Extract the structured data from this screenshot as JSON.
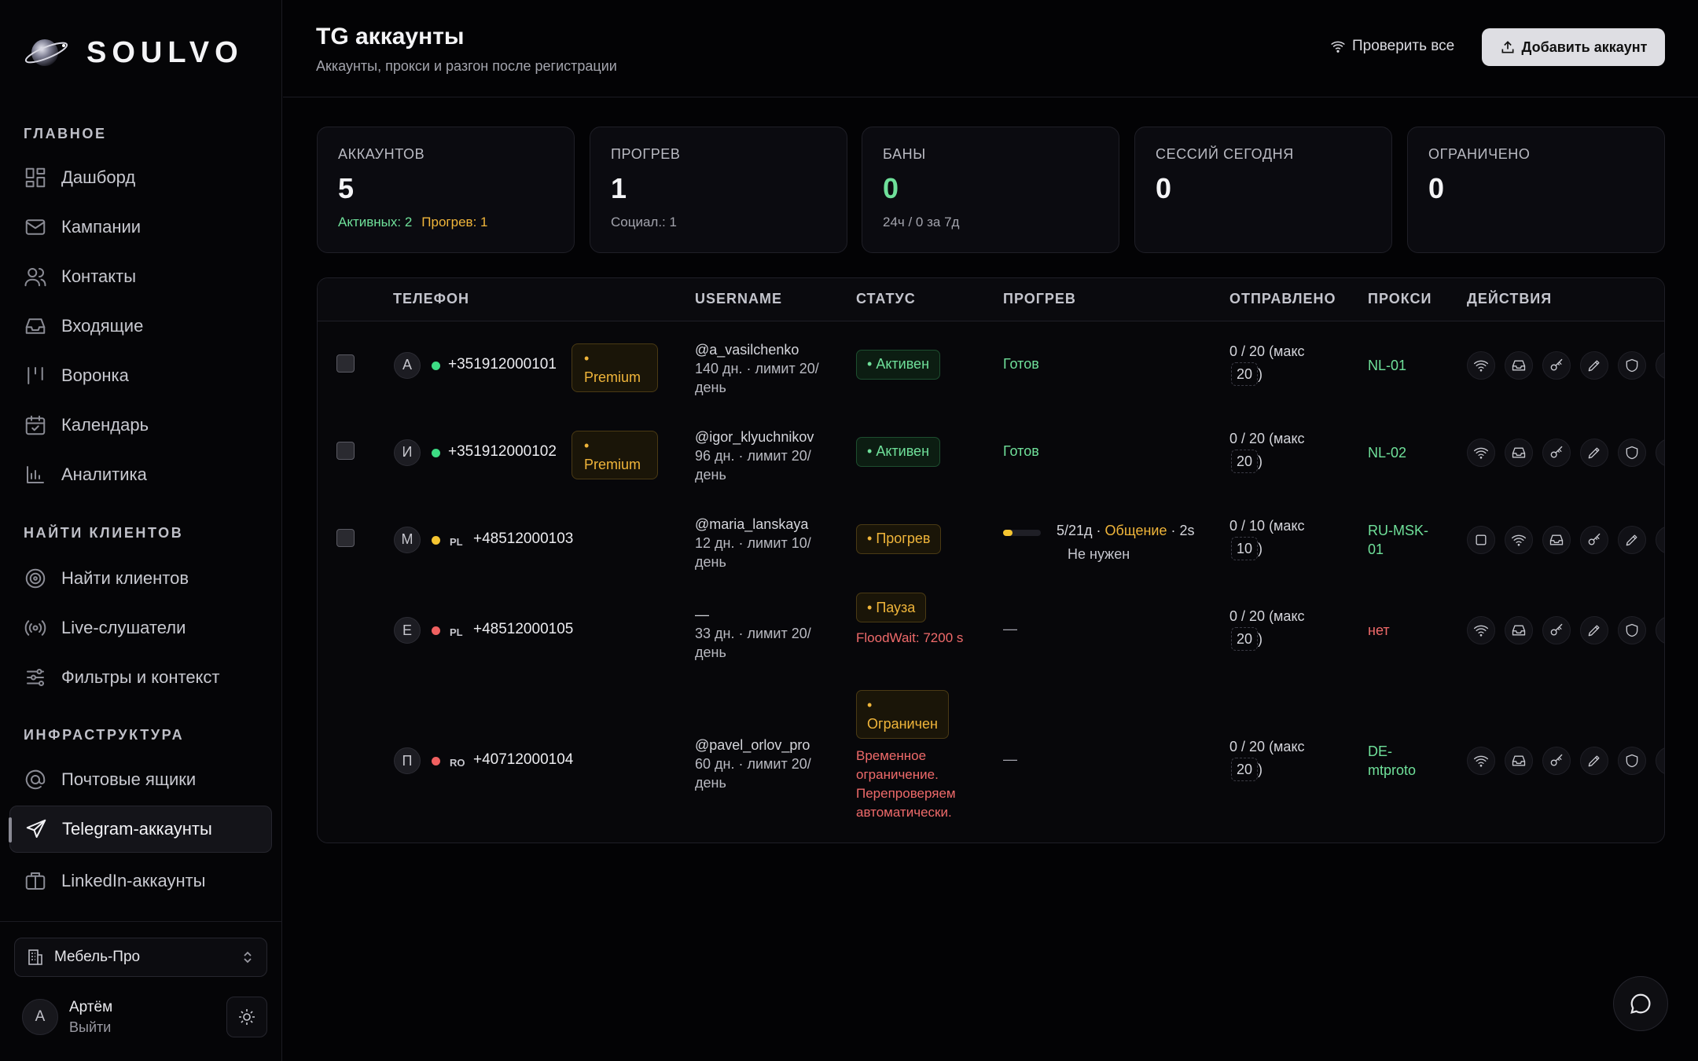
{
  "brand": {
    "name": "SOULVO"
  },
  "sidebar": {
    "sections": [
      {
        "label": "ГЛАВНОЕ",
        "items": [
          {
            "label": "Дашборд",
            "icon": "dashboard-icon"
          },
          {
            "label": "Кампании",
            "icon": "mail-icon"
          },
          {
            "label": "Контакты",
            "icon": "users-icon"
          },
          {
            "label": "Входящие",
            "icon": "inbox-icon"
          },
          {
            "label": "Воронка",
            "icon": "funnel-icon"
          },
          {
            "label": "Календарь",
            "icon": "calendar-icon"
          },
          {
            "label": "Аналитика",
            "icon": "chart-icon"
          }
        ]
      },
      {
        "label": "НАЙТИ КЛИЕНТОВ",
        "items": [
          {
            "label": "Найти клиентов",
            "icon": "target-icon"
          },
          {
            "label": "Live-слушатели",
            "icon": "broadcast-icon"
          },
          {
            "label": "Фильтры и контекст",
            "icon": "sliders-icon"
          }
        ]
      },
      {
        "label": "ИНФРАСТРУКТУРА",
        "items": [
          {
            "label": "Почтовые ящики",
            "icon": "at-icon"
          },
          {
            "label": "Telegram-аккаунты",
            "icon": "send-icon",
            "active": true
          },
          {
            "label": "LinkedIn-аккаунты",
            "icon": "briefcase-icon"
          }
        ]
      }
    ],
    "org": {
      "name": "Мебель-Про"
    },
    "user": {
      "initial": "А",
      "name": "Артём",
      "logout": "Выйти"
    }
  },
  "header": {
    "title": "TG аккаунты",
    "subtitle": "Аккаунты, прокси и разгон после регистрации",
    "check_all": "Проверить все",
    "add_account": "Добавить аккаунт"
  },
  "stats": [
    {
      "label": "АККАУНТОВ",
      "value": "5",
      "sub": [
        {
          "text": "Активных: 2",
          "color": "#6fe09a"
        },
        {
          "text": "Прогрев: 1",
          "color": "#f0b53a"
        }
      ]
    },
    {
      "label": "ПРОГРЕВ",
      "value": "1",
      "sub": [
        {
          "text": "Социал.: 1",
          "color": "#a3a4ad"
        }
      ]
    },
    {
      "label": "БАНЫ",
      "value": "0",
      "value_color": "#6fe09a",
      "sub": [
        {
          "text": "24ч / 0 за 7д",
          "color": "#a3a4ad"
        }
      ]
    },
    {
      "label": "СЕССИЙ СЕГОДНЯ",
      "value": "0",
      "sub": []
    },
    {
      "label": "ОГРАНИЧЕНО",
      "value": "0",
      "sub": []
    }
  ],
  "table": {
    "columns": [
      "ТЕЛЕФОН",
      "USERNAME",
      "СТАТУС",
      "ПРОГРЕВ",
      "ОТПРАВЛЕНО",
      "ПРОКСИ",
      "ДЕЙСТВИЯ"
    ],
    "rows": [
      {
        "initial": "А",
        "dot": "#3ddc84",
        "cc": "",
        "phone": "+351912000101",
        "premium": "Premium",
        "username": "@a_vasilchenko",
        "meta": "140 дн. · лимит 20/день",
        "status": "Активен",
        "status_kind": "green",
        "note": "",
        "warm": {
          "text": "Готов",
          "color": "#6fe09a"
        },
        "sent": "0 / 20",
        "max_label": "(макс",
        "max": "20",
        "proxy": "NL-01",
        "proxy_color": "#6fe09a",
        "actions": [
          "wifi-icon",
          "inbox-icon",
          "key-icon",
          "pencil-icon",
          "shield-icon"
        ]
      },
      {
        "initial": "И",
        "dot": "#3ddc84",
        "cc": "",
        "phone": "+351912000102",
        "premium": "Premium",
        "username": "@igor_klyuchnikov",
        "meta": "96 дн. · лимит 20/день",
        "status": "Активен",
        "status_kind": "green",
        "note": "",
        "warm": {
          "text": "Готов",
          "color": "#6fe09a"
        },
        "sent": "0 / 20",
        "max_label": "(макс",
        "max": "20",
        "proxy": "NL-02",
        "proxy_color": "#6fe09a",
        "actions": [
          "wifi-icon",
          "inbox-icon",
          "key-icon",
          "pencil-icon",
          "shield-icon"
        ]
      },
      {
        "initial": "М",
        "dot": "#f5c531",
        "cc": "PL",
        "phone": "+48512000103",
        "premium": "",
        "username": "@maria_lanskaya",
        "meta": "12 дн. · лимит 10/день",
        "status": "Прогрев",
        "status_kind": "amber",
        "note": "",
        "warm": {
          "progress": 0.24,
          "days": "5/21д",
          "phase": "Общение",
          "time": "2s",
          "extra": "Не нужен"
        },
        "sent": "0 / 10",
        "max_label": "(макс",
        "max": "10",
        "proxy": "RU-MSK-01",
        "proxy_color": "#6fe09a",
        "actions": [
          "square-icon",
          "wifi-icon",
          "inbox-icon",
          "key-icon",
          "pencil-icon"
        ]
      },
      {
        "initial": "Е",
        "dot": "#f06060",
        "cc": "PL",
        "phone": "+48512000105",
        "premium": "",
        "username": "—",
        "meta": "33 дн. · лимит 20/день",
        "status": "Пауза",
        "status_kind": "amber",
        "note": "FloodWait: 7200 s",
        "warm": {
          "text": "—",
          "color": "#a3a4ad"
        },
        "sent": "0 / 20",
        "max_label": "(макс",
        "max": "20",
        "proxy": "нет",
        "proxy_color": "#ef6a6a",
        "actions": [
          "wifi-icon",
          "inbox-icon",
          "key-icon",
          "pencil-icon",
          "shield-icon"
        ]
      },
      {
        "initial": "П",
        "dot": "#f06060",
        "cc": "RO",
        "phone": "+40712000104",
        "premium": "",
        "username": "@pavel_orlov_pro",
        "meta": "60 дн. · лимит 20/день",
        "status": "Ограничен",
        "status_kind": "amber",
        "note": "Временное ограничение. Перепроверяем автоматически.",
        "warm": {
          "text": "—",
          "color": "#a3a4ad"
        },
        "sent": "0 / 20",
        "max_label": "(макс",
        "max": "20",
        "proxy": "DE-mtproto",
        "proxy_color": "#6fe09a",
        "actions": [
          "wifi-icon",
          "inbox-icon",
          "key-icon",
          "pencil-icon",
          "shield-icon"
        ]
      }
    ]
  },
  "colors": {
    "accent": "#dedee3",
    "green": "#6fe09a",
    "amber": "#f0b53a",
    "red": "#ef6a6a"
  }
}
